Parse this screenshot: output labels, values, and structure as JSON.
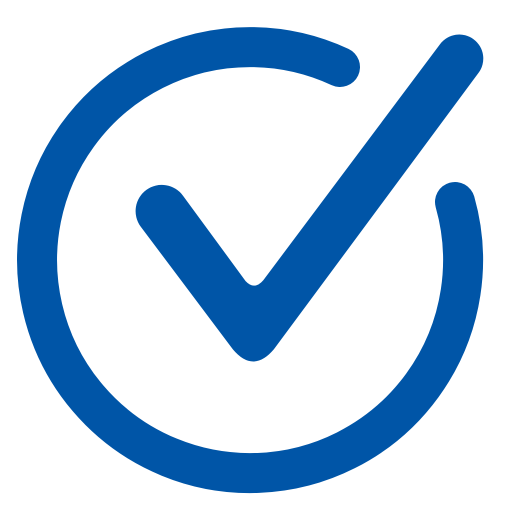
{
  "icon": {
    "name": "check-circle-icon",
    "color": "#0055A7",
    "background": "#FFFFFF"
  }
}
